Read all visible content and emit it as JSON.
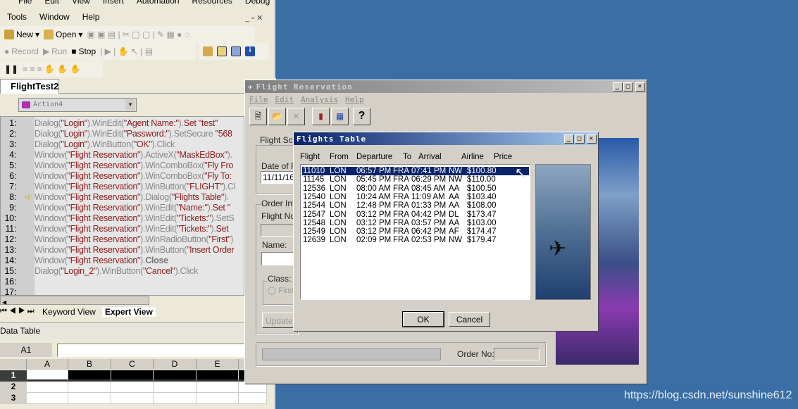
{
  "qtp": {
    "menu1": [
      "File",
      "Edit",
      "View",
      "Insert",
      "Automation",
      "Resources",
      "Debug"
    ],
    "menu2": [
      "Tools",
      "Window",
      "Help"
    ],
    "toolbar": {
      "new": "New",
      "open": "Open",
      "record": "Record",
      "run": "Run",
      "stop": "Stop"
    },
    "doc_tab": "FlightTest2",
    "action_select": "Action4",
    "current_line": 8,
    "code_lines": [
      [
        [
          "g",
          "Dialog("
        ],
        [
          "r",
          "\"Login\""
        ],
        [
          "g",
          ").WinEdit("
        ],
        [
          "r",
          "\"Agent Name:\""
        ],
        [
          "g",
          ")."
        ],
        [
          "r",
          "Set \"test\""
        ]
      ],
      [
        [
          "g",
          "Dialog("
        ],
        [
          "r",
          "\"Login\""
        ],
        [
          "g",
          ").WinEdit("
        ],
        [
          "r",
          "\"Password:\""
        ],
        [
          "g",
          ").SetSecure "
        ],
        [
          "r",
          "\"568"
        ]
      ],
      [
        [
          "g",
          "Dialog("
        ],
        [
          "r",
          "\"Login\""
        ],
        [
          "g",
          ").WinButton("
        ],
        [
          "r",
          "\"OK\""
        ],
        [
          "g",
          ").Click"
        ]
      ],
      [
        [
          "g",
          "Window("
        ],
        [
          "r",
          "\"Flight Reservation\""
        ],
        [
          "g",
          ").ActiveX("
        ],
        [
          "r",
          "\"MaskEdBox\""
        ],
        [
          "g",
          ")."
        ]
      ],
      [
        [
          "g",
          "Window("
        ],
        [
          "r",
          "\"Flight Reservation\""
        ],
        [
          "g",
          ").WinComboBox("
        ],
        [
          "r",
          "\"Fly Fro"
        ]
      ],
      [
        [
          "g",
          "Window("
        ],
        [
          "r",
          "\"Flight Reservation\""
        ],
        [
          "g",
          ").WinComboBox("
        ],
        [
          "r",
          "\"Fly To:"
        ]
      ],
      [
        [
          "g",
          "Window("
        ],
        [
          "r",
          "\"Flight Reservation\""
        ],
        [
          "g",
          ").WinButton("
        ],
        [
          "r",
          "\"FLIGHT\""
        ],
        [
          "g",
          ").Cl"
        ]
      ],
      [
        [
          "g",
          "Window("
        ],
        [
          "r",
          "\"Flight Reservation\""
        ],
        [
          "g",
          ").Dialog("
        ],
        [
          "r",
          "\"Flights Table\""
        ],
        [
          "g",
          ")."
        ]
      ],
      [
        [
          "g",
          "Window("
        ],
        [
          "r",
          "\"Flight Reservation\""
        ],
        [
          "g",
          ").WinEdit("
        ],
        [
          "r",
          "\"Name:\""
        ],
        [
          "g",
          ")."
        ],
        [
          "r",
          "Set \""
        ]
      ],
      [
        [
          "g",
          "Window("
        ],
        [
          "r",
          "\"Flight Reservation\""
        ],
        [
          "g",
          ").WinEdit("
        ],
        [
          "r",
          "\"Tickets:\""
        ],
        [
          "g",
          ").SetS"
        ]
      ],
      [
        [
          "g",
          "Window("
        ],
        [
          "r",
          "\"Flight Reservation\""
        ],
        [
          "g",
          ").WinEdit("
        ],
        [
          "r",
          "\"Tickets:\""
        ],
        [
          "g",
          ")."
        ],
        [
          "r",
          "Set"
        ]
      ],
      [
        [
          "g",
          "Window("
        ],
        [
          "r",
          "\"Flight Reservation\""
        ],
        [
          "g",
          ").WinRadioButton("
        ],
        [
          "r",
          "\"First\""
        ],
        [
          "g",
          ")"
        ]
      ],
      [
        [
          "g",
          "Window("
        ],
        [
          "r",
          "\"Flight Reservation\""
        ],
        [
          "g",
          ").WinButton("
        ],
        [
          "r",
          "\"Insert Order"
        ]
      ],
      [
        [
          "g",
          "Window("
        ],
        [
          "r",
          "\"Flight Reservation\""
        ],
        [
          "g",
          ")."
        ],
        [
          "k",
          "Close"
        ]
      ],
      [
        [
          "g",
          "Dialog("
        ],
        [
          "r",
          "\"Login_2\""
        ],
        [
          "g",
          ").WinButton("
        ],
        [
          "r",
          "\"Cancel\""
        ],
        [
          "g",
          ").Click"
        ]
      ],
      [],
      []
    ],
    "view_tabs": [
      "Keyword View",
      "Expert View"
    ],
    "data_table_title": "Data Table",
    "cell_ref": "A1",
    "columns": [
      "A",
      "B",
      "C",
      "D",
      "E"
    ],
    "rows": [
      "1",
      "2",
      "3"
    ]
  },
  "fr": {
    "title": "Flight Reservation",
    "menu": [
      "File",
      "Edit",
      "Analysis",
      "Help"
    ],
    "flight_schedule": "Flight Sch",
    "date_label": "Date of Fli",
    "date_value": "11/11/16",
    "order_info": "Order Info",
    "flight_no": "Flight No:",
    "name": "Name:",
    "class": "Class:",
    "first": "First",
    "update": "Update",
    "order_no": "Order No:"
  },
  "ft": {
    "title": "Flights Table",
    "headers": [
      "Flight",
      "From",
      "Departure",
      "To",
      "Arrival",
      "Airline",
      "Price"
    ],
    "selected_index": 0,
    "rows": [
      [
        "11010",
        "LON",
        "06:57 PM",
        "FRA",
        "07:41 PM",
        "NW",
        "$100.80"
      ],
      [
        "11145",
        "LON",
        "05:45 PM",
        "FRA",
        "06:29 PM",
        "NW",
        "$110.00"
      ],
      [
        "12536",
        "LON",
        "08:00 AM",
        "FRA",
        "08:45 AM",
        "AA",
        "$100.50"
      ],
      [
        "12540",
        "LON",
        "10:24 AM",
        "FRA",
        "11:09 AM",
        "AA",
        "$103.40"
      ],
      [
        "12544",
        "LON",
        "12:48 PM",
        "FRA",
        "01:33 PM",
        "AA",
        "$108.00"
      ],
      [
        "12547",
        "LON",
        "03:12 PM",
        "FRA",
        "04:42 PM",
        "DL",
        "$173.47"
      ],
      [
        "12548",
        "LON",
        "03:12 PM",
        "FRA",
        "03:57 PM",
        "AA",
        "$103.00"
      ],
      [
        "12549",
        "LON",
        "03:12 PM",
        "FRA",
        "06:42 PM",
        "AF",
        "$174.47"
      ],
      [
        "12639",
        "LON",
        "02:09 PM",
        "FRA",
        "02:53 PM",
        "NW",
        "$179.47"
      ]
    ],
    "ok": "OK",
    "cancel": "Cancel"
  },
  "watermark": "https://blog.csdn.net/sunshine612",
  "colors": {
    "desktop": "#3a6ea5",
    "active_title": "#0a246a",
    "selection": "#0a246a",
    "string": "#8b1a1a"
  }
}
